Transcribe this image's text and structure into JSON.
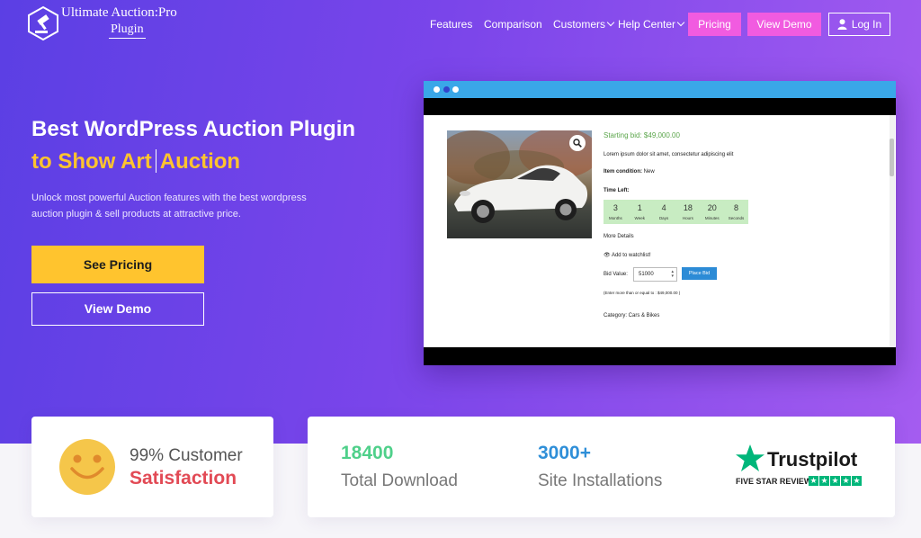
{
  "header": {
    "logo_line1": "Ultimate Auction:Pro",
    "logo_line2": "Plugin",
    "nav": {
      "features": "Features",
      "comparison": "Comparison",
      "customers": "Customers",
      "help_center": "Help Center",
      "pricing": "Pricing",
      "view_demo": "View Demo",
      "login": "Log In"
    }
  },
  "hero": {
    "title_line1": "Best WordPress Auction Plugin",
    "title_line2_a": "to Show Art",
    "title_line2_b": "Auction",
    "description": "Unlock most powerful Auction features with the best wordpress auction plugin & sell products at attractive price.",
    "cta_pricing": "See Pricing",
    "cta_demo": "View Demo"
  },
  "mockup": {
    "starting_bid": "Starting bid: $49,000.00",
    "lorem": "Lorem ipsum dolor sit amet, consectetur adipiscing elit",
    "item_condition_label": "Item condition:",
    "item_condition_value": "New",
    "time_left_label": "Time Left:",
    "countdown": [
      {
        "value": "3",
        "unit": "Months"
      },
      {
        "value": "1",
        "unit": "Week"
      },
      {
        "value": "4",
        "unit": "Days"
      },
      {
        "value": "18",
        "unit": "Hours"
      },
      {
        "value": "20",
        "unit": "Minutes"
      },
      {
        "value": "8",
        "unit": "Seconds"
      }
    ],
    "more_details": "More Details",
    "add_watchlist": "Add to watchlist!",
    "bid_value_label": "Bid Value:",
    "bid_value": "51000",
    "place_bid": "Place Bid",
    "bid_hint": "(Enter more than or equal to : $49,000.00 )",
    "category": "Category: Cars & Bikes"
  },
  "stats": {
    "satisfaction_line1": "99% Customer",
    "satisfaction_line2": "Satisfaction",
    "downloads_number": "18400",
    "downloads_label": "Total Download",
    "installs_number": "3000+",
    "installs_label": "Site Installations",
    "trustpilot_name": "Trustpilot",
    "trustpilot_review": "FIVE STAR REVIEW"
  },
  "colors": {
    "accent_yellow": "#ffc42e",
    "accent_pink": "#f15be0",
    "hero_purple": "#7a45ea",
    "satisfaction_red": "#e24a55",
    "download_green": "#4fd08a",
    "install_blue": "#2f8fd8",
    "trustpilot_green": "#00b67a"
  }
}
